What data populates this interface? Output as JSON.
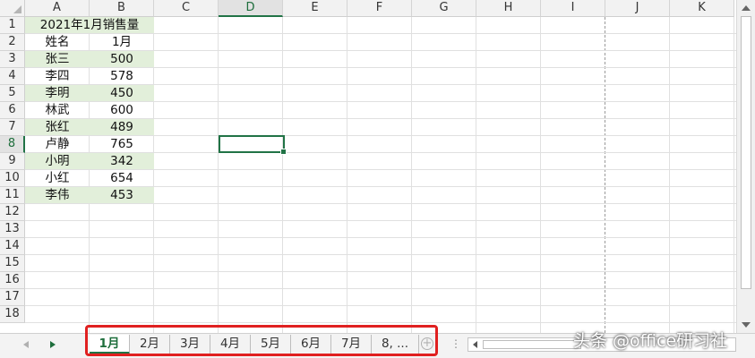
{
  "columns": [
    "A",
    "B",
    "C",
    "D",
    "E",
    "F",
    "G",
    "H",
    "I",
    "J",
    "K"
  ],
  "active_column": "D",
  "rows": [
    "1",
    "2",
    "3",
    "4",
    "5",
    "6",
    "7",
    "8",
    "9",
    "10",
    "11",
    "12",
    "13",
    "14",
    "15",
    "16",
    "17",
    "18"
  ],
  "active_row": "8",
  "cells": {
    "title": "2021年1月销售量",
    "header_name": "姓名",
    "header_month": "1月",
    "records": [
      {
        "name": "张三",
        "value": "500"
      },
      {
        "name": "李四",
        "value": "578"
      },
      {
        "name": "李明",
        "value": "450"
      },
      {
        "name": "林武",
        "value": "600"
      },
      {
        "name": "张红",
        "value": "489"
      },
      {
        "name": "卢静",
        "value": "765"
      },
      {
        "name": "小明",
        "value": "342"
      },
      {
        "name": "小红",
        "value": "654"
      },
      {
        "name": "李伟",
        "value": "453"
      }
    ]
  },
  "sheet_tabs": [
    "1月",
    "2月",
    "3月",
    "4月",
    "5月",
    "6月",
    "7月",
    "8, ..."
  ],
  "active_tab": "1月",
  "add_sheet_glyph": "+",
  "more_glyph": "⋮",
  "watermark": "头条 @office研习社",
  "colors": {
    "accent": "#217346",
    "band_fill": "#e2efda",
    "highlight_box": "#e02020"
  }
}
